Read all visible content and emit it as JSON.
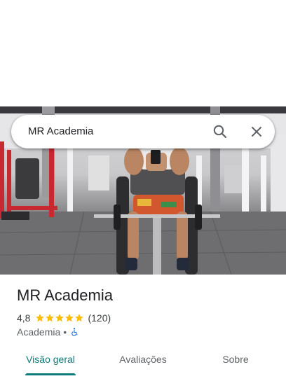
{
  "search": {
    "query": "MR Academia"
  },
  "place": {
    "name": "MR Academia",
    "rating": "4,8",
    "stars": 5,
    "review_count": "(120)",
    "category": "Academia",
    "separator": "•"
  },
  "tabs": [
    {
      "label": "Visão geral",
      "active": true
    },
    {
      "label": "Avaliações",
      "active": false
    },
    {
      "label": "Sobre",
      "active": false
    }
  ],
  "colors": {
    "accent": "#0b7a7a",
    "star": "#fbbc04",
    "accessibility": "#1a73e8"
  },
  "icons": [
    "search-icon",
    "close-icon",
    "star-icon",
    "wheelchair-accessible-icon"
  ]
}
